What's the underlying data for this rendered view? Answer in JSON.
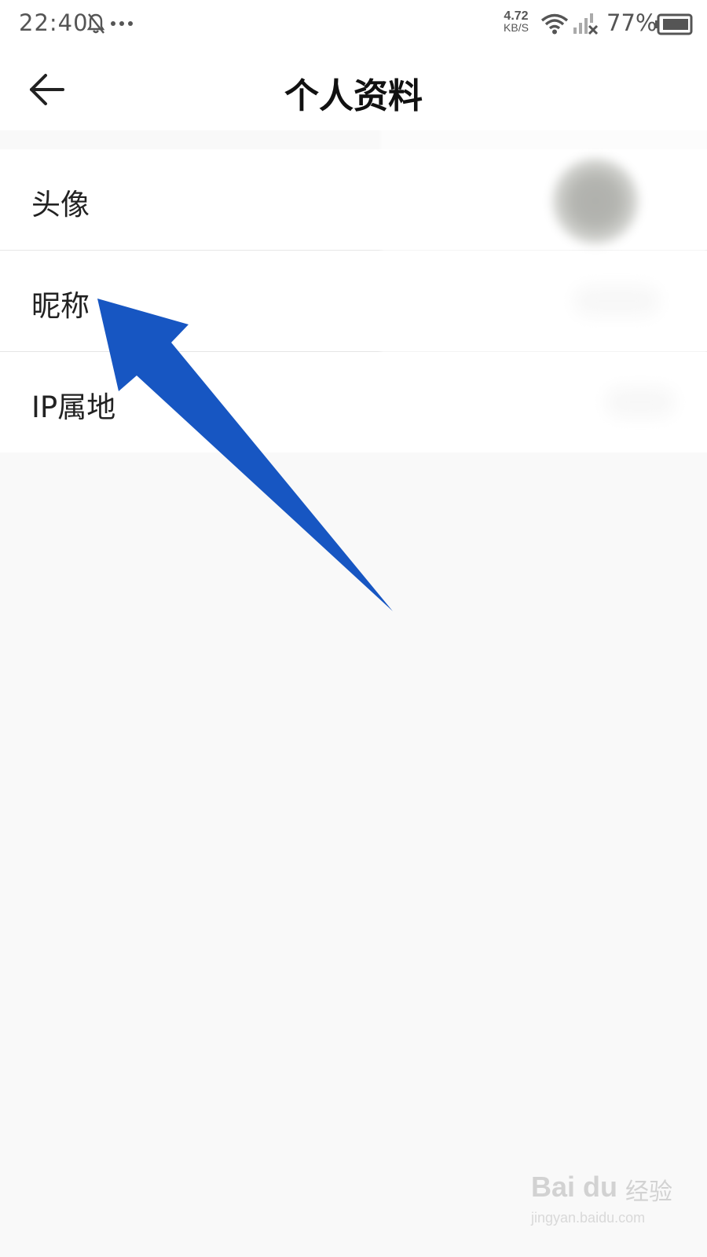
{
  "status_bar": {
    "time": "22:40",
    "net_speed_value": "4.72",
    "net_speed_unit": "KB/S",
    "battery_percent": "77%",
    "icons": [
      "bell-muted-icon",
      "more-dots-icon",
      "wifi-icon",
      "signal-no-service-icon",
      "battery-icon"
    ]
  },
  "header": {
    "title": "个人资料",
    "back_icon": "arrow-left-icon"
  },
  "profile_items": [
    {
      "label": "头像"
    },
    {
      "label": "昵称"
    },
    {
      "label": "IP属地"
    }
  ],
  "annotation": {
    "arrow_color": "#1756c2",
    "points_to": "昵称"
  },
  "watermark": {
    "logo": "Bai du",
    "text": "经验",
    "url": "jingyan.baidu.com"
  }
}
